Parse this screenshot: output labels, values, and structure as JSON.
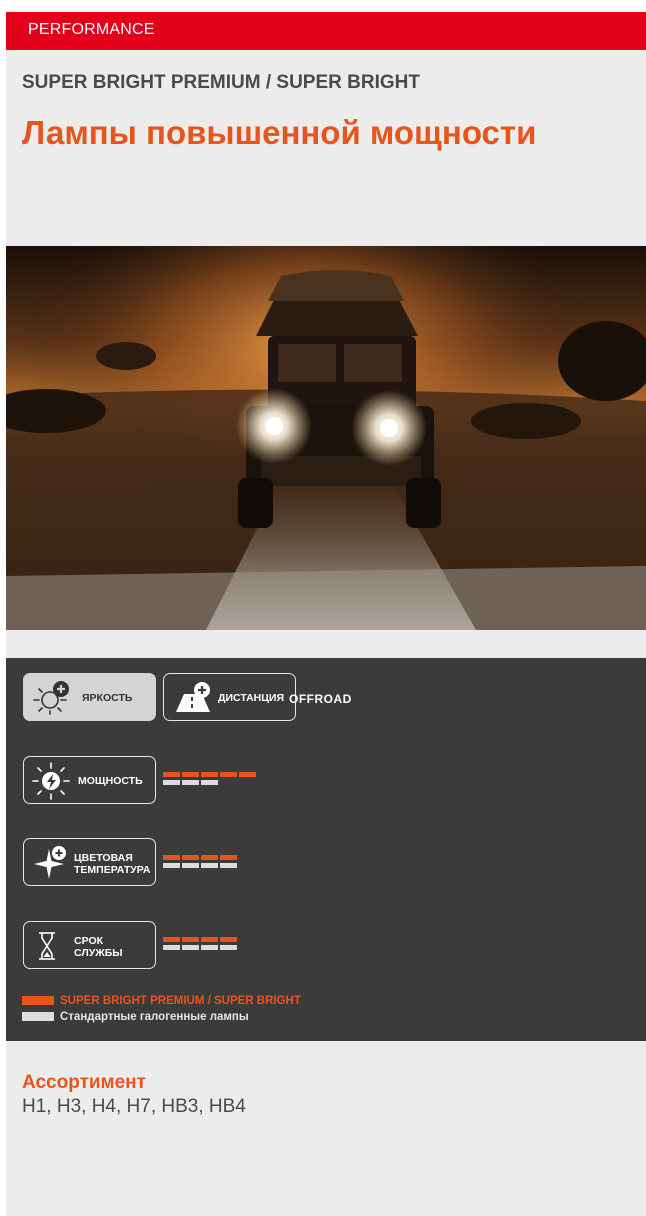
{
  "header": {
    "category": "PERFORMANCE",
    "subtitle": "SUPER BRIGHT PREMIUM / SUPER BRIGHT",
    "title": "Лампы повышенной мощности"
  },
  "features": {
    "brightness": "ЯРКОСТЬ",
    "distance": "ДИСТАНЦИЯ",
    "offroad": "OFFROAD",
    "power": "МОЩНОСТЬ",
    "color_temp_line1": "ЦВЕТОВАЯ",
    "color_temp_line2": "ТЕМПЕРАТУРА",
    "lifetime_line1": "СРОК",
    "lifetime_line2": "СЛУЖБЫ"
  },
  "ratings": {
    "power": {
      "premium": 5,
      "standard": 3
    },
    "color_temperature": {
      "premium": 4,
      "standard": 4
    },
    "lifetime": {
      "premium": 4,
      "standard": 4
    }
  },
  "legend": {
    "premium": "SUPER BRIGHT PREMIUM / SUPER BRIGHT",
    "standard": "Стандартные галогенные лампы"
  },
  "range": {
    "title": "Ассортимент",
    "items": "H1, H3, H4, H7, HB3, HB4"
  },
  "colors": {
    "brand_red": "#e2001a",
    "accent_orange": "#e8551c",
    "panel_dark": "#3b3b3b"
  },
  "icons": [
    "sun-plus-icon",
    "road-plus-icon",
    "sun-bolt-icon",
    "starburst-plus-icon",
    "hourglass-icon"
  ]
}
